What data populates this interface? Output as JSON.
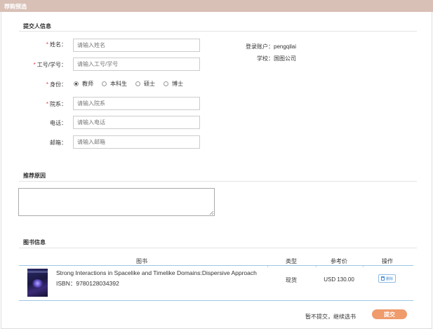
{
  "header": {
    "title": "荐购预选"
  },
  "submitter": {
    "section_title": "提交人信息",
    "fields": {
      "name": {
        "label": "姓名：",
        "required": true,
        "placeholder": "请输入姓名"
      },
      "id": {
        "label": "工号/学号：",
        "required": true,
        "placeholder": "请输入工号/学号"
      },
      "identity": {
        "label": "身份：",
        "required": true,
        "options": [
          {
            "label": "教师",
            "selected": true
          },
          {
            "label": "本科生",
            "selected": false
          },
          {
            "label": "硕士",
            "selected": false
          },
          {
            "label": "博士",
            "selected": false
          }
        ]
      },
      "dept": {
        "label": "院系：",
        "required": true,
        "placeholder": "请输入院系"
      },
      "phone": {
        "label": "电话：",
        "required": false,
        "placeholder": "请输入电话"
      },
      "email": {
        "label": "邮箱：",
        "required": false,
        "placeholder": "请输入邮箱"
      }
    },
    "account": {
      "label": "登录账户：",
      "value": "pengqilai"
    },
    "school": {
      "label": "学校：",
      "value": "国图公司"
    },
    "required_mark": "*"
  },
  "reason": {
    "section_title": "推荐原因",
    "value": ""
  },
  "books": {
    "section_title": "图书信息",
    "columns": [
      "图书",
      "类型",
      "参考价",
      "操作"
    ],
    "rows": [
      {
        "title": "Strong Interactions in Spacelike and Timelike Domains:Dispersive Approach",
        "isbn": "ISBN：9780128034392",
        "type": "现货",
        "price": "USD 130.00",
        "action": "删除"
      }
    ]
  },
  "footer": {
    "later_label": "暂不提交，继续选书",
    "submit_label": "提交"
  },
  "colors": {
    "header_bg": "#d8c0b6",
    "submit_bg": "#ef9b6c",
    "required": "#e4393c",
    "table_line": "#9ec6e3"
  }
}
